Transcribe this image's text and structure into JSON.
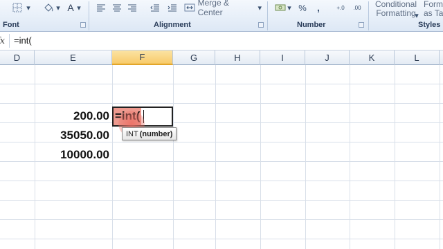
{
  "ribbon": {
    "merge_center_label": "Merge & Center",
    "conditional_formatting_label_1": "Conditional",
    "conditional_formatting_label_2": "Formatting",
    "format_as_table_label_1": "Form",
    "format_as_table_label_2": "as Tab",
    "percent_label": "%",
    "comma_label": ",",
    "dec_inc_label": "+.0",
    "dec_dec_label": ".00",
    "groups": {
      "font": "Font",
      "alignment": "Alignment",
      "number": "Number",
      "styles": "Styles"
    }
  },
  "formula_bar": {
    "fx_label": "fx",
    "value": "=int("
  },
  "columns": [
    "D",
    "E",
    "F",
    "G",
    "H",
    "I",
    "J",
    "K",
    "L"
  ],
  "active_column": "F",
  "cells": {
    "e1": "200.00",
    "e2": "35050.00",
    "e3": "10000.00",
    "f1_editing": "=int("
  },
  "tooltip": {
    "function": "INT",
    "arg": "(number)"
  },
  "colors": {
    "ribbon_bg": "#dde8f5",
    "active_header": "#f8cb6a",
    "formula_highlight": "#ee9a8f"
  }
}
